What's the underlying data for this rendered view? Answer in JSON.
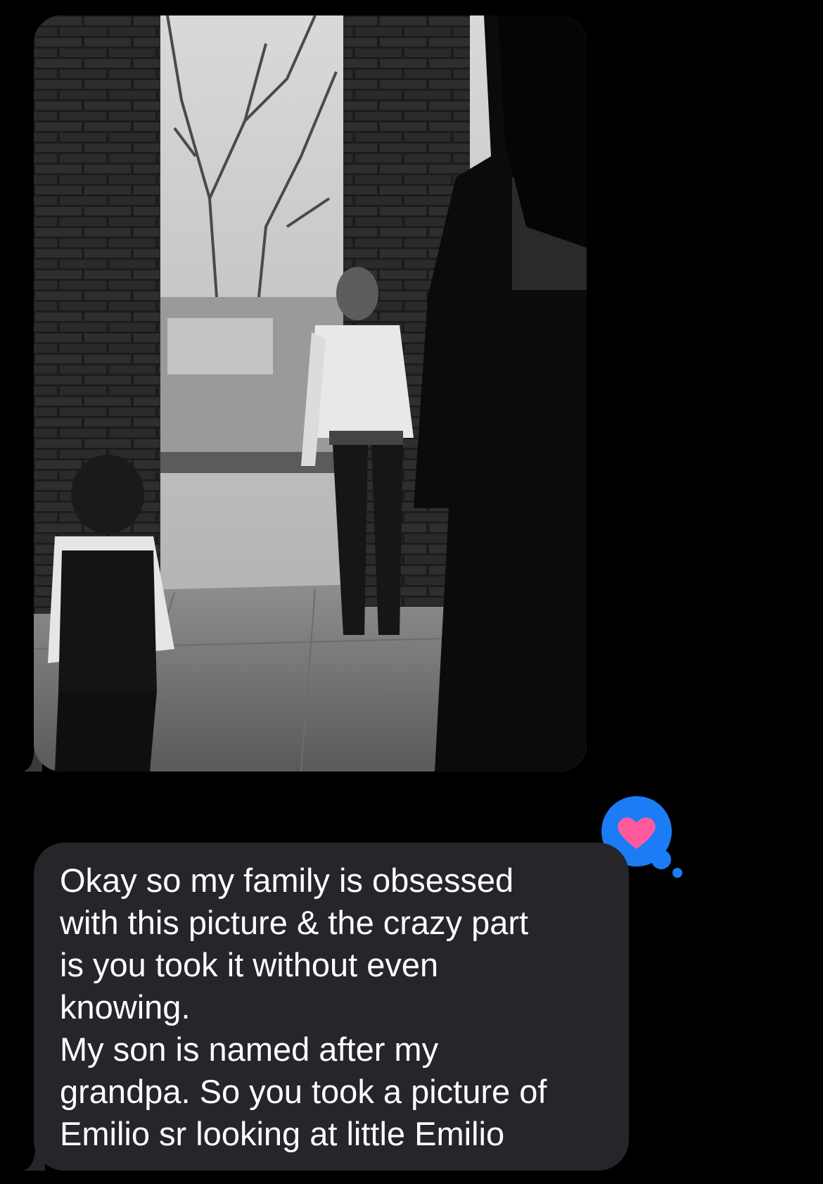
{
  "conversation": {
    "photo_message": {
      "type": "image",
      "description_icon": "photo-icon"
    },
    "reaction": {
      "icon": "heart-icon",
      "bubble_color": "#1b7cf5",
      "heart_color": "#ff5a9e"
    },
    "text_message": {
      "text": "Okay so my family is obsessed\nwith this picture & the crazy part\nis you took it without even\nknowing.\nMy son is named after my\ngrandpa. So you took a picture of\nEmilio sr looking at little Emilio",
      "bubble_color": "#26252a",
      "text_color": "#ffffff"
    }
  },
  "theme": {
    "background": "#000000"
  }
}
